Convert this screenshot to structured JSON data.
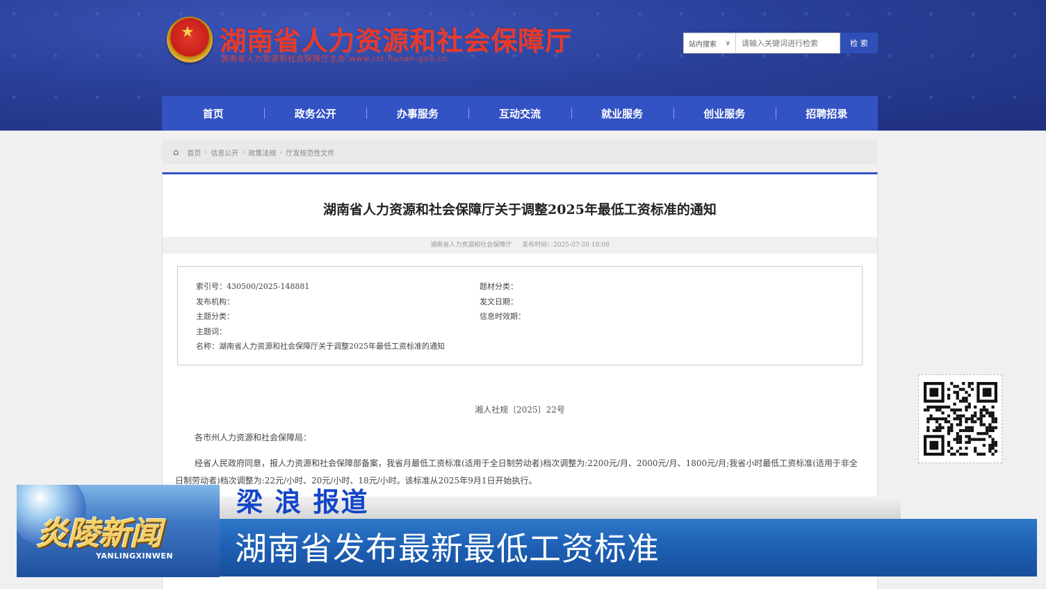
{
  "site": {
    "title": "湖南省人力资源和社会保障厅",
    "subtitle": "湖南省人力资源和社会保障厅主办  www.rst.hunan.gov.cn"
  },
  "search": {
    "scope": "站内搜索",
    "placeholder": "请输入关键词进行检索",
    "button": "检 索"
  },
  "nav": [
    "首页",
    "政务公开",
    "办事服务",
    "互动交流",
    "就业服务",
    "创业服务",
    "招聘招录"
  ],
  "breadcrumb": [
    "首页",
    "信息公开",
    "政策法规",
    "厅发规范性文件"
  ],
  "article": {
    "title": "湖南省人力资源和社会保障厅关于调整2025年最低工资标准的通知",
    "source": "湖南省人力资源和社会保障厅",
    "published": "发布时间：2025-07-30 18:08",
    "info": {
      "index_no": "索引号：430500/2025-148881",
      "issuer": "发布机构：",
      "topic_class": "主题分类：",
      "keywords": "主题词：",
      "name": "名称：湖南省人力资源和社会保障厅关于调整2025年最低工资标准的通知",
      "genre_class": "题材分类：",
      "issue_date": "发文日期：",
      "validity": "信息时效期："
    },
    "doc_number": "湘人社规〔2025〕22号",
    "recipient": "各市州人力资源和社会保障局：",
    "body": "经省人民政府同意，报人力资源和社会保障部备案，我省月最低工资标准(适用于全日制劳动者)档次调整为:2200元/月、2000元/月、1800元/月;我省小时最低工资标准(适用于非全日制劳动者)档次调整为:22元/小时、20元/小时、18元/小时。该标准从2025年9月1日开始执行。"
  },
  "news": {
    "brand": "炎陵新闻",
    "brand_en": "YANLINGXINWEN",
    "reporter": "梁  浪    报道",
    "headline": "湖南省发布最新最低工资标准"
  },
  "colors": {
    "header_blue": "#2a3f98",
    "nav_blue": "#3352c4",
    "title_red": "#e8392c",
    "news_blue": "#1d5fb3",
    "reporter_blue": "#1346c8"
  }
}
